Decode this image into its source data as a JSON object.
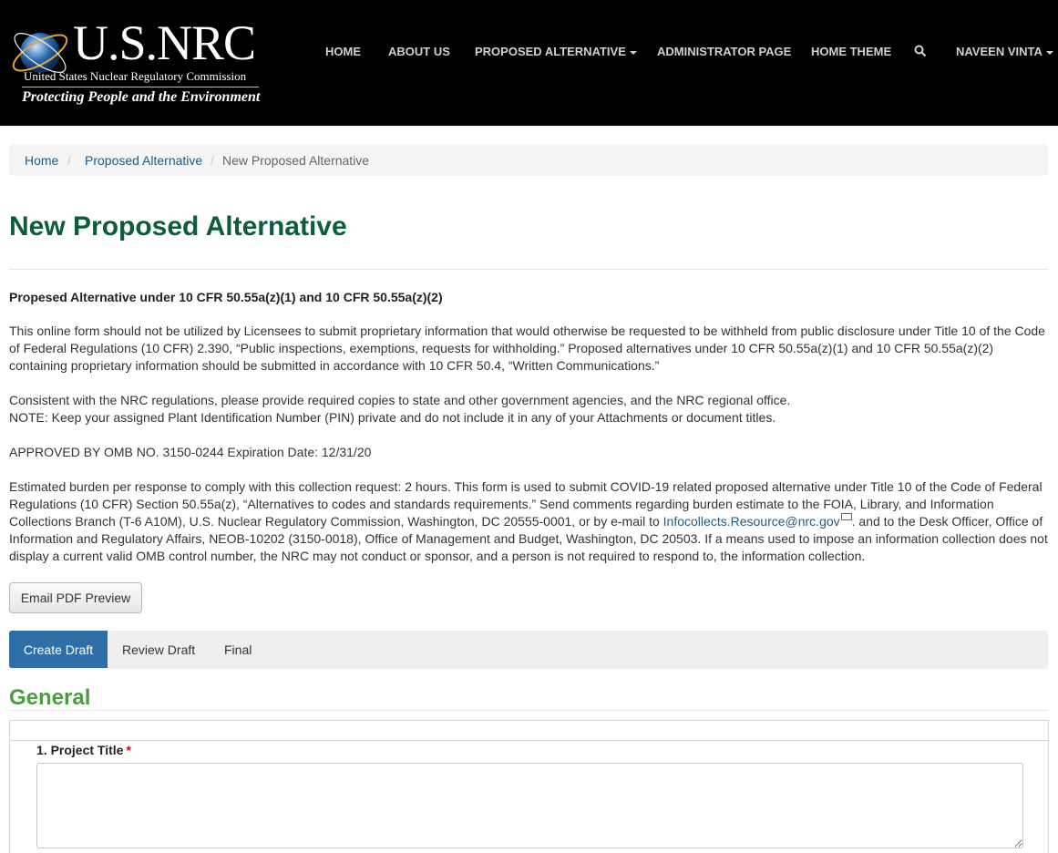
{
  "header": {
    "logo": {
      "wordmark": "U.S.NRC",
      "subtitle": "United States Nuclear Regulatory Commission",
      "tagline": "Protecting People and the Environment"
    },
    "nav": [
      {
        "label": "HOME"
      },
      {
        "label": "ABOUT US"
      },
      {
        "label": "PROPOSED ALTERNATIVE"
      },
      {
        "label": "ADMINISTRATOR PAGE"
      },
      {
        "label": "HOME THEME"
      },
      {
        "label": "NAVEEN VINTA"
      }
    ],
    "icons": {
      "search": "search-icon"
    }
  },
  "breadcrumb": {
    "items": [
      "Home",
      "Proposed Alternative",
      "New Proposed Alternative"
    ],
    "separator": "/"
  },
  "page": {
    "title": "New Proposed Alternative",
    "subheading": "Propesed Alternative under 10 CFR 50.55a(z)(1) and 10 CFR 50.55a(z)(2)",
    "para1": "This online form should not be utilized by Licensees to submit proprietary information that would otherwise be requested to be withheld from public disclosure under Title 10 of the Code of Federal Regulations (10 CFR) 2.390, “Public inspections, exemptions, requests for withholding.” Proposed alternatives under 10 CFR 50.55a(z)(1) and 10 CFR 50.55a(z)(2) containing proprietary information should be submitted in accordance with 10 CFR 50.4, “Written Communications.”",
    "para2a": "Consistent with the NRC regulations, please provide required copies to state and other government agencies, and the NRC regional office.",
    "para2b": "NOTE: Keep your assigned Plant Identification Number (PIN) private and do not include it in any of your Attachments or document titles.",
    "para3": "APPROVED BY OMB NO. 3150-0244 Expiration Date: 12/31/20",
    "para4_before": "Estimated burden per response to comply with this collection request: 2 hours. This form is used to submit COVID-19 related proposed alternative under Title 10 of the Code of Federal Regulations (10 CFR) Section 50.55a(z), “Alternatives to codes and standards requirements.” Send comments regarding burden estimate to the FOIA, Library, and Information Collections Branch (T-6 A10M), U.S. Nuclear Regulatory Commission, Washington, DC 20555-0001, or by e-mail to ",
    "para4_link": "Infocollects.Resource@nrc.gov",
    "para4_after": ". and to the Desk Officer, Office of Information and Regulatory Affairs, NEOB-10202 (3150-0018), Office of Management and Budget, Washington, DC 20503. If a means used to impose an information collection does not display a current valid OMB control number, the NRC may not conduct or sponsor, and a person is not required to respond to, the information collection."
  },
  "buttons": {
    "email_pdf": "Email PDF Preview"
  },
  "tabs": [
    {
      "label": "Create Draft",
      "active": true
    },
    {
      "label": "Review Draft",
      "active": false
    },
    {
      "label": "Final",
      "active": false
    }
  ],
  "form": {
    "section_title": "General",
    "fields": [
      {
        "label": "1. Project Title",
        "required_mark": "*",
        "value": ""
      }
    ]
  },
  "colors": {
    "header_bg": "#000000",
    "title_green": "#0b5d3b",
    "section_green": "#4f9a45",
    "active_tab": "#2f6fa7",
    "link": "#1f5a8a"
  }
}
